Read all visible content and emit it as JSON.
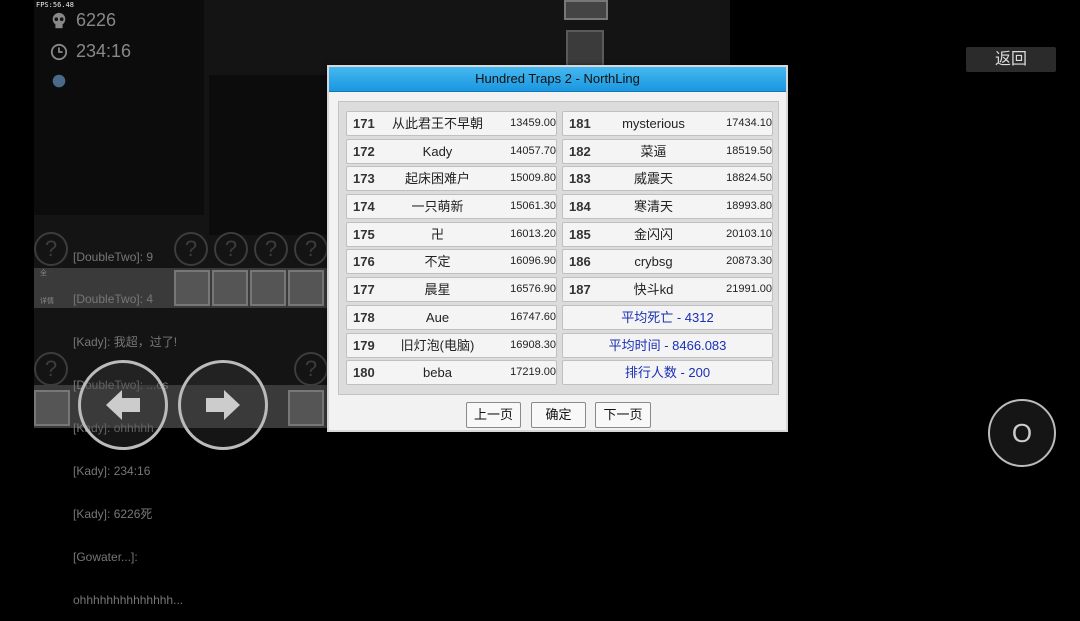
{
  "hud": {
    "fps": "FPS:56.48",
    "deaths": "6226",
    "time": "234:16",
    "side_labels": [
      "全",
      "详情"
    ]
  },
  "chat": {
    "lines": [
      "[DoubleTwo]: 9",
      "[DoubleTwo]: 4",
      "[Kady]: 我超，过了!",
      "[DoubleTwo]: ...cs",
      "[Kady]: ohhhhh",
      "[Kady]: 234:16",
      "[Kady]: 6226死",
      "[Gowater...]:",
      "ohhhhhhhhhhhhhh..."
    ]
  },
  "controls": {
    "back_label": "返回",
    "action_label": "O",
    "left_arrow": "left-arrow-icon",
    "right_arrow": "right-arrow-icon"
  },
  "dialog": {
    "title": "Hundred Traps 2 - NorthLing",
    "left_rows": [
      {
        "rank": "171",
        "name": "从此君王不早朝",
        "time": "13459.00"
      },
      {
        "rank": "172",
        "name": "Kady",
        "time": "14057.70"
      },
      {
        "rank": "173",
        "name": "起床困难户",
        "time": "15009.80"
      },
      {
        "rank": "174",
        "name": "一只萌新",
        "time": "15061.30"
      },
      {
        "rank": "175",
        "name": "卍",
        "time": "16013.20"
      },
      {
        "rank": "176",
        "name": "不定",
        "time": "16096.90"
      },
      {
        "rank": "177",
        "name": "晨星",
        "time": "16576.90"
      },
      {
        "rank": "178",
        "name": "Aue",
        "time": "16747.60"
      },
      {
        "rank": "179",
        "name": "旧灯泡(电脑)",
        "time": "16908.30"
      },
      {
        "rank": "180",
        "name": "beba",
        "time": "17219.00"
      }
    ],
    "right_rows": [
      {
        "rank": "181",
        "name": "mysterious",
        "time": "17434.10"
      },
      {
        "rank": "182",
        "name": "菜逼",
        "time": "18519.50"
      },
      {
        "rank": "183",
        "name": "威震天",
        "time": "18824.50"
      },
      {
        "rank": "184",
        "name": "寒清天",
        "time": "18993.80"
      },
      {
        "rank": "185",
        "name": "金闪闪",
        "time": "20103.10"
      },
      {
        "rank": "186",
        "name": "crybsg",
        "time": "20873.30"
      },
      {
        "rank": "187",
        "name": "快斗kd",
        "time": "21991.00"
      }
    ],
    "summary": {
      "avg_deaths": "平均死亡 - 4312",
      "avg_time": "平均时间 - 8466.083",
      "player_count": "排行人数 - 200"
    },
    "buttons": {
      "prev": "上一页",
      "ok": "确定",
      "next": "下一页"
    }
  },
  "colors": {
    "title_bar": "#1a97e0",
    "summary_text": "#1a2fb5"
  }
}
